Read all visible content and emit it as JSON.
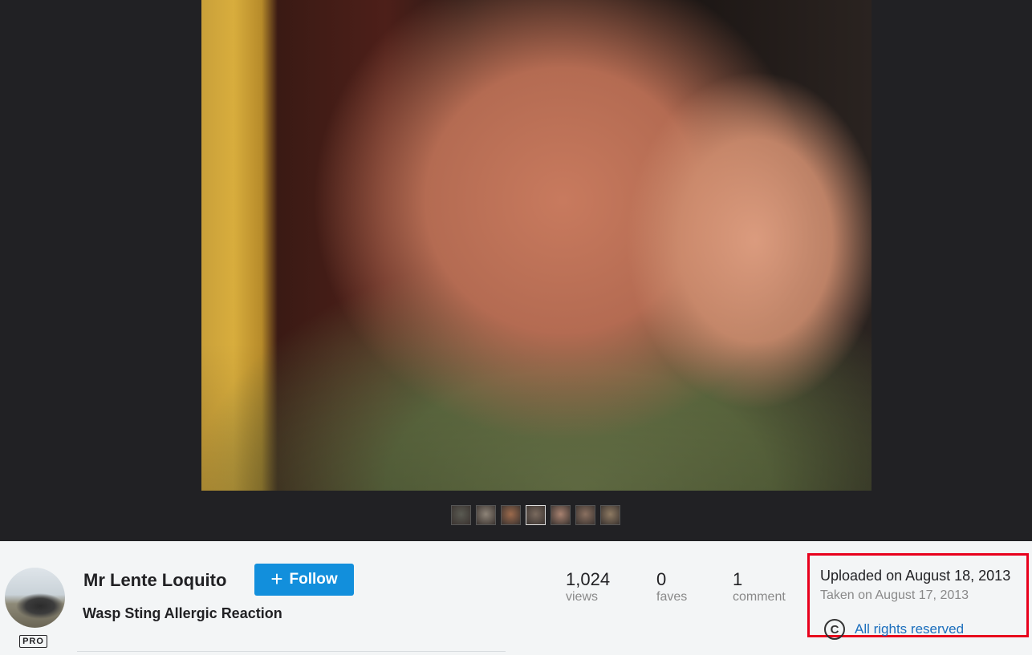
{
  "photo": {
    "thumbnails": [
      "thumb-1",
      "thumb-2",
      "thumb-3",
      "thumb-4",
      "thumb-5",
      "thumb-6",
      "thumb-7"
    ],
    "thumbnail_colors": [
      "#5a5a52",
      "#8e8478",
      "#9c6a4c",
      "#7a6a5e",
      "#a88270",
      "#8a7060",
      "#8e7a62"
    ],
    "active_thumbnail": 3
  },
  "owner": {
    "name": "Mr Lente Loquito",
    "badge": "PRO",
    "follow_label": "Follow",
    "follow_icon": "plus-icon"
  },
  "photo_title": "Wasp Sting Allergic Reaction",
  "stats": [
    {
      "value": "1,024",
      "label": "views"
    },
    {
      "value": "0",
      "label": "faves"
    },
    {
      "value": "1",
      "label": "comment"
    }
  ],
  "dates": {
    "uploaded": "Uploaded on August 18, 2013",
    "taken": "Taken on August 17, 2013"
  },
  "license": {
    "icon": "copyright-icon",
    "icon_glyph": "C",
    "label": "All rights reserved"
  },
  "colors": {
    "accent": "#128fdc",
    "highlight_box": "#e8001c",
    "link": "#1c6fbd"
  }
}
